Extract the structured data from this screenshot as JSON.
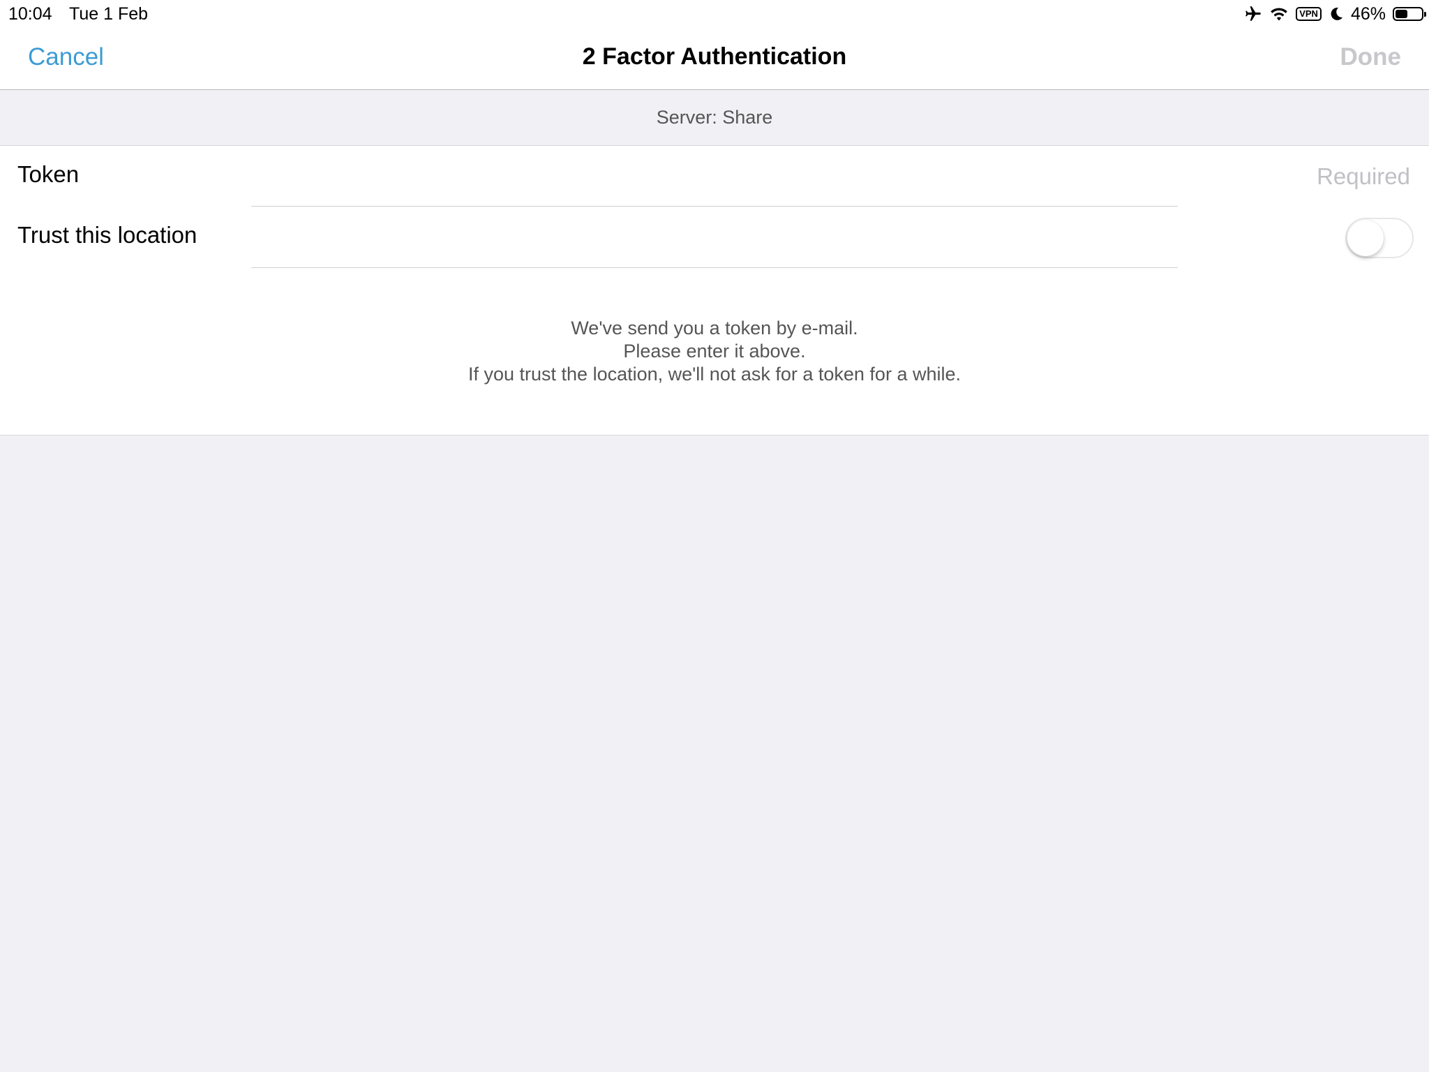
{
  "status_bar": {
    "time": "10:04",
    "date": "Tue 1 Feb",
    "vpn_label": "VPN",
    "battery_percent": "46%",
    "battery_level": 0.46,
    "icons": [
      "airplane-icon",
      "wifi-icon",
      "vpn-icon",
      "moon-icon",
      "battery-icon"
    ]
  },
  "nav": {
    "cancel_label": "Cancel",
    "title": "2 Factor Authentication",
    "done_label": "Done"
  },
  "section": {
    "header": "Server: Share"
  },
  "form": {
    "token_label": "Token",
    "token_value": "",
    "token_placeholder": "Required",
    "trust_label": "Trust this location",
    "trust_enabled": false
  },
  "info": {
    "lines": [
      "We've send you a token by e-mail.",
      "Please enter it above.",
      "If you trust the location, we'll not ask for a token for a while."
    ]
  },
  "colors": {
    "accent": "#3d9bd4",
    "disabled": "#c7c7cc",
    "background": "#f0f0f5"
  }
}
